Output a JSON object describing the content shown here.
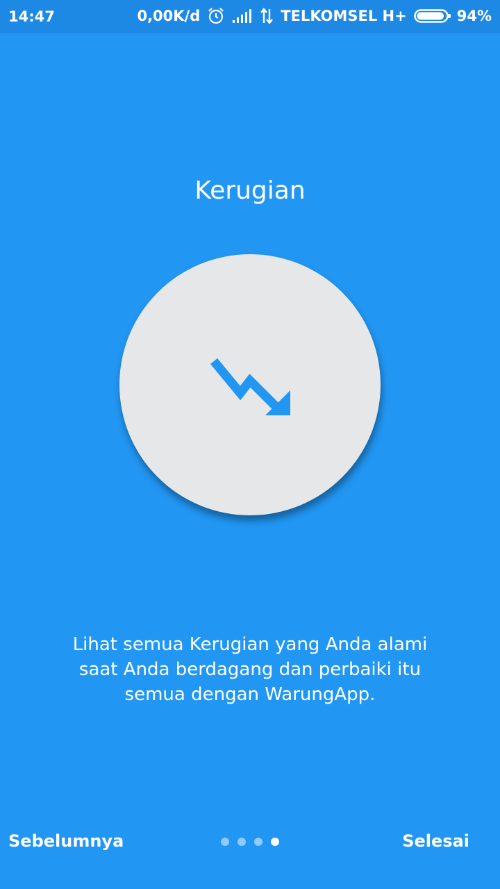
{
  "status_bar": {
    "time": "14:47",
    "speed": "0,00K/d",
    "carrier": "TELKOMSEL H+",
    "battery": "94%",
    "battery_level": 0.94
  },
  "onboarding": {
    "title": "Kerugian",
    "icon": "trending-down-icon",
    "description": "Lihat semua Kerugian yang Anda alami saat Anda berdagang dan perbaiki itu semua dengan WarungApp.",
    "page_count": 4,
    "current_page": 4
  },
  "nav": {
    "prev_label": "Sebelumnya",
    "done_label": "Selesai"
  },
  "colors": {
    "background": "#2196F3",
    "status_bar": "#1E88E5",
    "circle": "#E6E7E8",
    "icon": "#2196F3"
  }
}
